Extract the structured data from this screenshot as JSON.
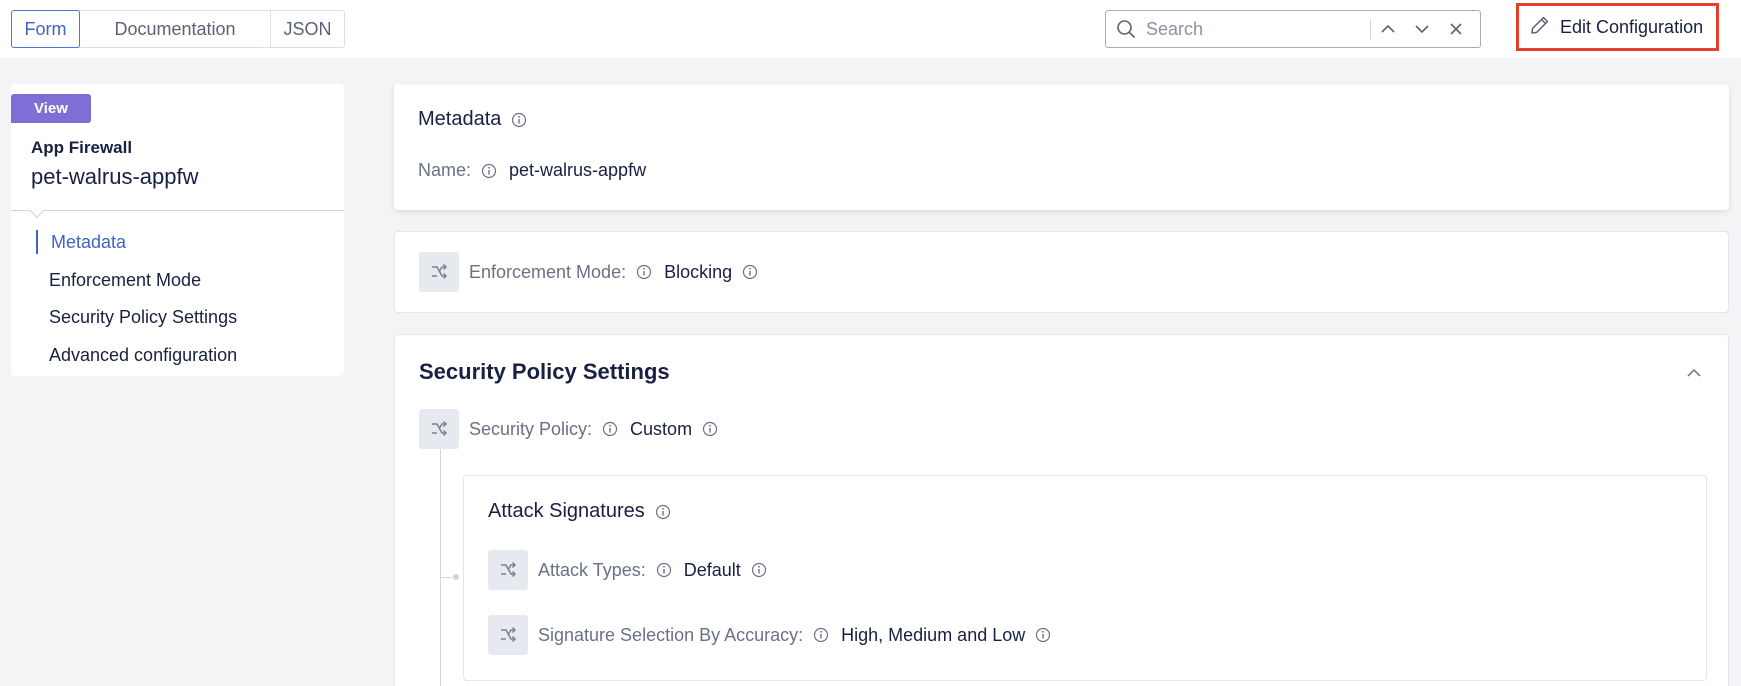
{
  "tabs": [
    {
      "label": "Form",
      "active": true
    },
    {
      "label": "Documentation",
      "active": false
    },
    {
      "label": "JSON",
      "active": false
    }
  ],
  "search": {
    "placeholder": "Search",
    "value": ""
  },
  "edit_button": {
    "label": "Edit Configuration",
    "icon": "pencil-icon",
    "highlight_color": "#e4402c"
  },
  "sidebar": {
    "badge": "View",
    "object_type": "App Firewall",
    "object_name": "pet-walrus-appfw",
    "nav": [
      {
        "label": "Metadata",
        "active": true
      },
      {
        "label": "Enforcement Mode",
        "active": false
      },
      {
        "label": "Security Policy Settings",
        "active": false
      },
      {
        "label": "Advanced configuration",
        "active": false
      }
    ]
  },
  "metadata": {
    "title": "Metadata",
    "name_label": "Name:",
    "name_value": "pet-walrus-appfw"
  },
  "enforcement": {
    "label": "Enforcement Mode:",
    "value": "Blocking"
  },
  "security_policy": {
    "title": "Security Policy Settings",
    "policy_label": "Security Policy:",
    "policy_value": "Custom",
    "attack_signatures": {
      "title": "Attack Signatures",
      "attack_types_label": "Attack Types:",
      "attack_types_value": "Default",
      "accuracy_label": "Signature Selection By Accuracy:",
      "accuracy_value": "High, Medium and Low"
    }
  },
  "colors": {
    "accent": "#3f63c8",
    "badge": "#7d6fd6",
    "text": "#1a2042",
    "muted": "#6b7184"
  }
}
